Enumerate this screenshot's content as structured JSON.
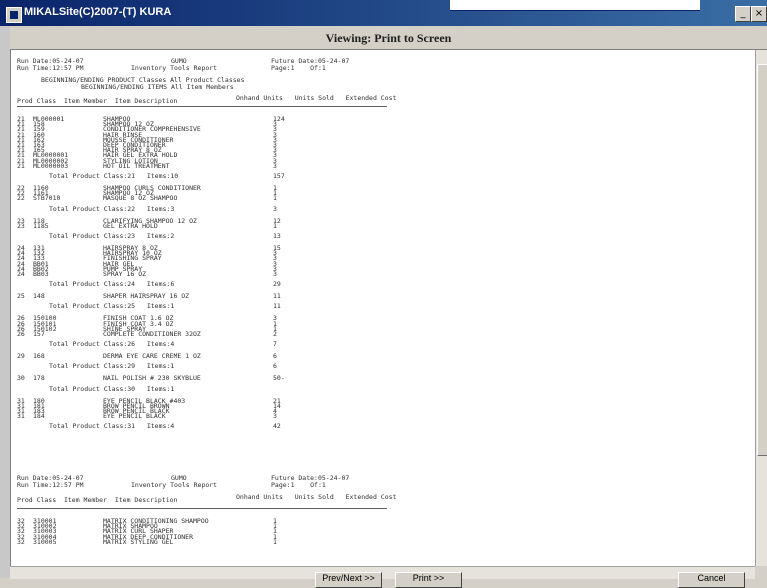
{
  "window": {
    "title": "MIKALSite(C)2007-(T) KURA",
    "controls": [
      "minimize",
      "maximize",
      "close"
    ]
  },
  "viewer": {
    "title": "Viewing: Print to Screen"
  },
  "report": {
    "page_header": {
      "left1": "Run Date:05-24-07",
      "left2": "Run Time:12:57 PM",
      "center1": "GUMO",
      "center2": "Inventory Tools Report",
      "right1": "Future Date:05-24-07",
      "right2": "Page:1    Of:1",
      "section1": "BEGINNING/ENDING PRODUCT Classes All Product Classes",
      "section2": "BEGINNING/ENDING ITEMS All Item Members"
    },
    "columns": {
      "left": "Prod Class  Item Member  Item Description",
      "right": "Onhand Units   Units Sold   Extended Cost"
    },
    "groups": [
      {
        "rows": [
          [
            "21",
            "ML000001",
            "SHAMPOO",
            "124"
          ],
          [
            "21",
            "158",
            "SHAMPOO 12 OZ",
            "3"
          ],
          [
            "21",
            "159",
            "CONDITIONER COMPREHENSIVE",
            "3"
          ],
          [
            "21",
            "160",
            "HAIR RINSE",
            "3"
          ],
          [
            "21",
            "162",
            "MOUSSE CONDITIONER",
            "3"
          ],
          [
            "21",
            "163",
            "DEEP CONDITIONER",
            "3"
          ],
          [
            "21",
            "165",
            "HAIR SPRAY 8 OZ",
            "3"
          ],
          [
            "21",
            "ML0000001",
            "HAIR GEL EXTRA HOLD",
            "3"
          ],
          [
            "21",
            "ML0000002",
            "STYLING LOTION",
            "3"
          ],
          [
            "21",
            "ML0000003",
            "HOT OIL TREATMENT",
            "3"
          ]
        ],
        "total": "Total Product Class:21   Items:10",
        "total_qty": "157"
      },
      {
        "rows": [
          [
            "22",
            "1160",
            "SHAMPOO CURLS CONDITIONER",
            "1"
          ],
          [
            "22",
            "1161",
            "SHAMPOO 12 OZ",
            "1"
          ],
          [
            "22",
            "STB7010",
            "MASQUE 8 OZ SHAMPOO",
            "1"
          ]
        ],
        "total": "Total Product Class:22   Items:3",
        "total_qty": "3"
      },
      {
        "rows": [
          [
            "23",
            "118",
            "CLARIFYING SHAMPOO 12 OZ",
            "12"
          ],
          [
            "23",
            "1185",
            "GEL EXTRA HOLD",
            "1"
          ]
        ],
        "total": "Total Product Class:23   Items:2",
        "total_qty": "13"
      },
      {
        "rows": [
          [
            "24",
            "131",
            "HAIRSPRAY 8 OZ",
            "15"
          ],
          [
            "24",
            "132",
            "HAIRSPRAY 10 OZ",
            "3"
          ],
          [
            "24",
            "133",
            "FINISHING SPRAY",
            "3"
          ],
          [
            "24",
            "BB01",
            "HAIR GEL",
            "3"
          ],
          [
            "24",
            "BB02",
            "PUMP SPRAY",
            "3"
          ],
          [
            "24",
            "BB03",
            "SPRAY 16 OZ",
            "3"
          ]
        ],
        "total": "Total Product Class:24   Items:6",
        "total_qty": "29"
      },
      {
        "rows": [
          [
            "25",
            "148",
            "SHAPER HAIRSPRAY 16 OZ",
            "11"
          ]
        ],
        "total": "Total Product Class:25   Items:1",
        "total_qty": "11"
      },
      {
        "rows": [
          [
            "26",
            "150100",
            "FINISH COAT 1.6 OZ",
            "3"
          ],
          [
            "26",
            "150101",
            "FINISH COAT 3.4 OZ",
            "1"
          ],
          [
            "26",
            "150102",
            "SHINE SPRAY",
            "1"
          ],
          [
            "26",
            "157",
            "COMPLETE CONDITIONER 32OZ",
            "2"
          ]
        ],
        "total": "Total Product Class:26   Items:4",
        "total_qty": "7"
      },
      {
        "rows": [
          [
            "29",
            "168",
            "DERMA EYE CARE CREME 1 OZ",
            "6"
          ]
        ],
        "total": "Total Product Class:29   Items:1",
        "total_qty": "6"
      },
      {
        "rows": [
          [
            "30",
            "178",
            "NAIL POLISH # 230 SKYBLUE",
            "50-"
          ]
        ],
        "total": "Total Product Class:30   Items:1",
        "total_qty": ""
      },
      {
        "rows": [
          [
            "31",
            "180",
            "EYE PENCIL BLACK #403",
            "21"
          ],
          [
            "31",
            "181",
            "BROW PENCIL BROWN",
            "14"
          ],
          [
            "31",
            "183",
            "BROW PENCIL BLACK",
            "4"
          ],
          [
            "31",
            "184",
            "EYE PENCIL BLACK",
            "3"
          ]
        ],
        "total": "Total Product Class:31   Items:4",
        "total_qty": "42"
      }
    ],
    "page2_rows": [
      [
        "32",
        "310001",
        "MATRIX CONDITIONING SHAMPOO",
        "1"
      ],
      [
        "32",
        "310002",
        "MATRIX SHAMPOO",
        "1"
      ],
      [
        "32",
        "310003",
        "MATRIX CURL SHAPER",
        "1"
      ],
      [
        "32",
        "310004",
        "MATRIX DEEP CONDITIONER",
        "1"
      ],
      [
        "32",
        "310005",
        "MATRIX STYLING GEL",
        "1"
      ]
    ]
  },
  "buttons": {
    "b1": "Prev/Next >>",
    "b2": "Print >>",
    "b3": "Cancel"
  }
}
